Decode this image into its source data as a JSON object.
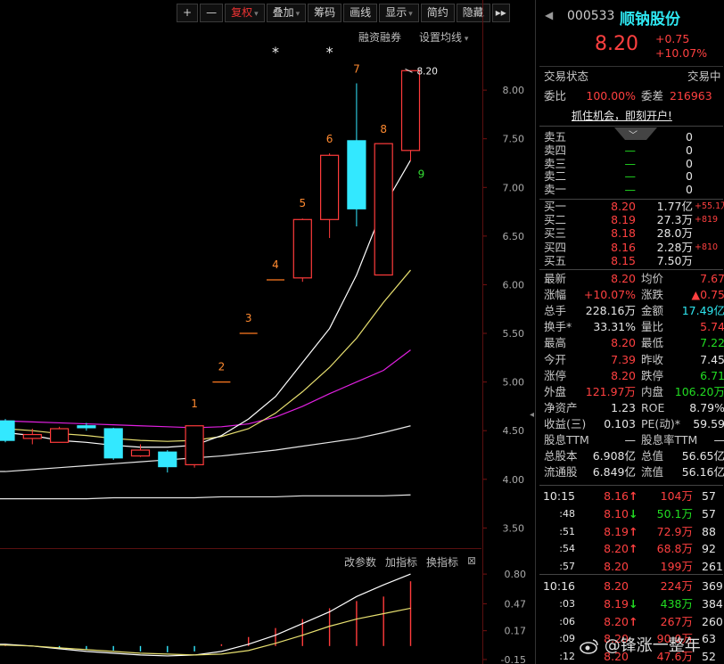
{
  "toolbar": {
    "items": [
      "+",
      "—",
      "复权",
      "叠加",
      "筹码",
      "画线",
      "显示",
      "简约",
      "隐藏"
    ],
    "more": "▸▸"
  },
  "chart_header": {
    "margin": "融资融券",
    "ma_settings": "设置均线"
  },
  "chart_data": {
    "type": "candlestick",
    "price_ticks": [
      "8.00",
      "7.50",
      "7.00",
      "6.50",
      "6.00",
      "5.50",
      "5.00",
      "4.50",
      "4.00",
      "3.50"
    ],
    "price_tick_values": [
      8.0,
      7.5,
      7.0,
      6.5,
      6.0,
      5.5,
      5.0,
      4.5,
      4.0,
      3.5
    ],
    "ylim": [
      3.32,
      8.45
    ],
    "candles": [
      {
        "o": 4.4,
        "c": 4.6,
        "h": 4.62,
        "l": 4.38,
        "color": "cyan"
      },
      {
        "o": 4.42,
        "c": 4.46,
        "h": 4.52,
        "l": 4.36,
        "color": "red"
      },
      {
        "o": 4.38,
        "c": 4.52,
        "h": 4.54,
        "l": 4.38,
        "color": "red"
      },
      {
        "o": 4.55,
        "c": 4.53,
        "h": 4.58,
        "l": 4.5,
        "color": "cyan"
      },
      {
        "o": 4.52,
        "c": 4.22,
        "h": 4.53,
        "l": 4.2,
        "color": "cyan"
      },
      {
        "o": 4.24,
        "c": 4.3,
        "h": 4.36,
        "l": 4.23,
        "color": "red"
      },
      {
        "o": 4.28,
        "c": 4.13,
        "h": 4.3,
        "l": 4.07,
        "color": "cyan"
      },
      {
        "o": 4.15,
        "c": 4.55,
        "h": 4.55,
        "l": 4.12,
        "color": "red"
      },
      {
        "o": 5.0,
        "c": 5.0,
        "h": 5.0,
        "l": 5.0,
        "color": "orange"
      },
      {
        "o": 5.5,
        "c": 5.5,
        "h": 5.5,
        "l": 5.5,
        "color": "orange"
      },
      {
        "o": 6.05,
        "c": 6.05,
        "h": 6.05,
        "l": 6.05,
        "color": "orange"
      },
      {
        "o": 6.07,
        "c": 6.67,
        "h": 6.68,
        "l": 6.03,
        "color": "red"
      },
      {
        "o": 6.67,
        "c": 7.33,
        "h": 7.35,
        "l": 6.48,
        "color": "red"
      },
      {
        "o": 7.48,
        "c": 6.78,
        "h": 8.07,
        "l": 6.6,
        "color": "cyan"
      },
      {
        "o": 6.1,
        "c": 7.45,
        "h": 7.45,
        "l": 6.1,
        "color": "red"
      },
      {
        "o": 7.38,
        "c": 8.2,
        "h": 8.2,
        "l": 7.27,
        "color": "red"
      }
    ],
    "labels": [
      {
        "i": 7,
        "text": "1",
        "value": 4.74
      },
      {
        "i": 8,
        "text": "2",
        "value": 5.12
      },
      {
        "i": 9,
        "text": "3",
        "value": 5.62
      },
      {
        "i": 10,
        "text": "4",
        "value": 6.17
      },
      {
        "i": 11,
        "text": "5",
        "value": 6.8
      },
      {
        "i": 12,
        "text": "6",
        "value": 7.46
      },
      {
        "i": 13,
        "text": "7",
        "value": 8.18
      },
      {
        "i": 14,
        "text": "8",
        "value": 7.56
      },
      {
        "i": 15,
        "text": "9",
        "value": 7.1
      }
    ],
    "last_price_label": "8.20",
    "stars": [
      {
        "i": 10,
        "symbol": "*"
      },
      {
        "i": 12,
        "symbol": "*"
      }
    ],
    "ma_white": [
      4.48,
      4.45,
      4.4,
      4.38,
      4.35,
      4.33,
      4.33,
      4.35,
      4.45,
      4.62,
      4.85,
      5.2,
      5.55,
      6.1,
      6.8,
      7.28
    ],
    "ma_yellow": [
      4.52,
      4.5,
      4.47,
      4.45,
      4.42,
      4.4,
      4.39,
      4.4,
      4.44,
      4.52,
      4.68,
      4.9,
      5.15,
      5.45,
      5.82,
      6.15
    ],
    "ma_magenta": [
      4.6,
      4.59,
      4.58,
      4.57,
      4.56,
      4.55,
      4.54,
      4.53,
      4.54,
      4.57,
      4.64,
      4.75,
      4.88,
      5.0,
      5.12,
      5.33
    ],
    "ma_light": [
      4.08,
      4.1,
      4.12,
      4.14,
      4.16,
      4.18,
      4.2,
      4.22,
      4.24,
      4.27,
      4.3,
      4.34,
      4.38,
      4.42,
      4.48,
      4.55
    ],
    "ma_flat": [
      3.8,
      3.8,
      3.8,
      3.8,
      3.81,
      3.81,
      3.81,
      3.81,
      3.82,
      3.82,
      3.82,
      3.83,
      3.83,
      3.83,
      3.83,
      3.84
    ]
  },
  "indicator": {
    "buttons": [
      "改参数",
      "加指标",
      "换指标"
    ],
    "close": "⊠",
    "ticks": [
      "0.80",
      "0.47",
      "0.17",
      "-0.15"
    ],
    "tick_values": [
      0.8,
      0.47,
      0.17,
      -0.15
    ],
    "ylim": [
      -0.2,
      0.92
    ],
    "white_line": [
      0.02,
      0.0,
      -0.03,
      -0.06,
      -0.08,
      -0.1,
      -0.11,
      -0.1,
      -0.06,
      0.02,
      0.12,
      0.25,
      0.38,
      0.55,
      0.68,
      0.8
    ],
    "yellow_line": [
      0.01,
      0.0,
      -0.02,
      -0.04,
      -0.06,
      -0.08,
      -0.09,
      -0.1,
      -0.09,
      -0.05,
      0.03,
      0.12,
      0.22,
      0.3,
      0.36,
      0.42
    ],
    "bars": [
      0.02,
      0.0,
      -0.02,
      -0.04,
      -0.05,
      -0.06,
      -0.07,
      -0.06,
      0.02,
      0.1,
      0.2,
      0.3,
      0.42,
      0.5,
      0.55,
      0.72
    ]
  },
  "stock": {
    "code": "000533",
    "name": "顺钠股份",
    "price": "8.20",
    "change": "+0.75",
    "change_pct": "+10.07%"
  },
  "status": {
    "state_label": "交易状态",
    "state_value": "交易中",
    "weibi_label": "委比",
    "weibi_value": "100.00%",
    "weicha_label": "委差",
    "weicha_value": "216963",
    "promo": "抓住机会，即刻开户!"
  },
  "asks": [
    {
      "label": "卖五",
      "price": "",
      "vol": "0"
    },
    {
      "label": "卖四",
      "price": "—",
      "vol": "0"
    },
    {
      "label": "卖三",
      "price": "—",
      "vol": "0"
    },
    {
      "label": "卖二",
      "price": "—",
      "vol": "0"
    },
    {
      "label": "卖一",
      "price": "—",
      "vol": "0"
    }
  ],
  "bids": [
    {
      "label": "买一",
      "price": "8.20",
      "vol": "1.77亿",
      "chg": "+55.1万"
    },
    {
      "label": "买二",
      "price": "8.19",
      "vol": "27.3万",
      "chg": "+819"
    },
    {
      "label": "买三",
      "price": "8.18",
      "vol": "28.0万",
      "chg": ""
    },
    {
      "label": "买四",
      "price": "8.16",
      "vol": "2.28万",
      "chg": "+810"
    },
    {
      "label": "买五",
      "price": "8.15",
      "vol": "7.50万",
      "chg": ""
    }
  ],
  "quote": [
    {
      "l1": "最新",
      "v1": "8.20",
      "c1": "red",
      "l2": "均价",
      "v2": "7.67",
      "c2": "red"
    },
    {
      "l1": "涨幅",
      "v1": "+10.07%",
      "c1": "red",
      "l2": "涨跌",
      "v2": "▲0.75",
      "c2": "red"
    },
    {
      "l1": "总手",
      "v1": "228.16万",
      "c1": "white",
      "l2": "金额",
      "v2": "17.49亿",
      "c2": "cyan"
    },
    {
      "l1": "换手*",
      "v1": "33.31%",
      "c1": "white",
      "l2": "量比",
      "v2": "5.74",
      "c2": "red"
    },
    {
      "l1": "最高",
      "v1": "8.20",
      "c1": "red",
      "l2": "最低",
      "v2": "7.22",
      "c2": "green"
    },
    {
      "l1": "今开",
      "v1": "7.39",
      "c1": "red",
      "l2": "昨收",
      "v2": "7.45",
      "c2": "white"
    },
    {
      "l1": "涨停",
      "v1": "8.20",
      "c1": "red",
      "l2": "跌停",
      "v2": "6.71",
      "c2": "green"
    },
    {
      "l1": "外盘",
      "v1": "121.97万",
      "c1": "red",
      "l2": "内盘",
      "v2": "106.20万",
      "c2": "green"
    },
    {
      "l1": "净资产",
      "v1": "1.23",
      "c1": "white",
      "l2": "ROE",
      "v2": "8.79%",
      "c2": "white"
    },
    {
      "l1": "收益(三)",
      "v1": "0.103",
      "c1": "white",
      "l2": "PE(动)*",
      "v2": "59.59",
      "c2": "white"
    },
    {
      "l1": "股息TTM",
      "v1": "—",
      "c1": "white",
      "l2": "股息率TTM",
      "v2": "—",
      "c2": "white"
    },
    {
      "l1": "总股本",
      "v1": "6.908亿",
      "c1": "white",
      "l2": "总值",
      "v2": "56.65亿",
      "c2": "white"
    },
    {
      "l1": "流通股",
      "v1": "6.849亿",
      "c1": "white",
      "l2": "流值",
      "v2": "56.16亿",
      "c2": "white"
    }
  ],
  "ticks": [
    {
      "time": "10:15",
      "price": "8.16",
      "arrow": "↑",
      "acolor": "red",
      "vol": "104万",
      "vcolor": "red",
      "n": "57"
    },
    {
      "time": ":48",
      "price": "8.10",
      "arrow": "↓",
      "acolor": "green",
      "vol": "50.1万",
      "vcolor": "green",
      "n": "57"
    },
    {
      "time": ":51",
      "price": "8.19",
      "arrow": "↑",
      "acolor": "red",
      "vol": "72.9万",
      "vcolor": "red",
      "n": "88"
    },
    {
      "time": ":54",
      "price": "8.20",
      "arrow": "↑",
      "acolor": "red",
      "vol": "68.8万",
      "vcolor": "red",
      "n": "92"
    },
    {
      "time": ":57",
      "price": "8.20",
      "arrow": "",
      "acolor": "red",
      "vol": "199万",
      "vcolor": "red",
      "n": "261"
    },
    {
      "time": "10:16",
      "price": "8.20",
      "arrow": "",
      "acolor": "red",
      "vol": "224万",
      "vcolor": "red",
      "n": "369"
    },
    {
      "time": ":03",
      "price": "8.19",
      "arrow": "↓",
      "acolor": "green",
      "vol": "438万",
      "vcolor": "green",
      "n": "384"
    },
    {
      "time": ":06",
      "price": "8.20",
      "arrow": "↑",
      "acolor": "red",
      "vol": "267万",
      "vcolor": "red",
      "n": "260"
    },
    {
      "time": ":09",
      "price": "8.20",
      "arrow": "",
      "acolor": "red",
      "vol": "90.0万",
      "vcolor": "red",
      "n": "63"
    },
    {
      "time": ":12",
      "price": "8.20",
      "arrow": "",
      "acolor": "red",
      "vol": "47.6万",
      "vcolor": "red",
      "n": "52"
    }
  ],
  "watermark": "@锋涨一整年"
}
